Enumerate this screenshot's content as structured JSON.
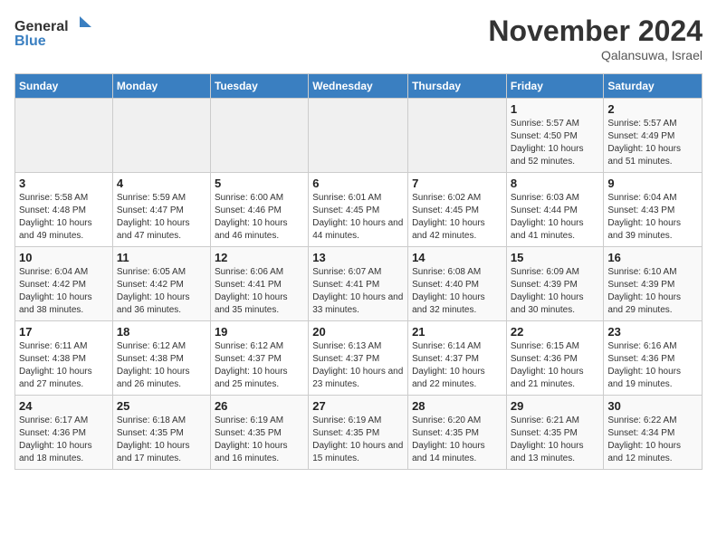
{
  "logo": {
    "general": "General",
    "blue": "Blue"
  },
  "header": {
    "month": "November 2024",
    "location": "Qalansuwa, Israel"
  },
  "weekdays": [
    "Sunday",
    "Monday",
    "Tuesday",
    "Wednesday",
    "Thursday",
    "Friday",
    "Saturday"
  ],
  "weeks": [
    [
      {
        "day": "",
        "sunrise": "",
        "sunset": "",
        "daylight": ""
      },
      {
        "day": "",
        "sunrise": "",
        "sunset": "",
        "daylight": ""
      },
      {
        "day": "",
        "sunrise": "",
        "sunset": "",
        "daylight": ""
      },
      {
        "day": "",
        "sunrise": "",
        "sunset": "",
        "daylight": ""
      },
      {
        "day": "",
        "sunrise": "",
        "sunset": "",
        "daylight": ""
      },
      {
        "day": "1",
        "sunrise": "Sunrise: 5:57 AM",
        "sunset": "Sunset: 4:50 PM",
        "daylight": "Daylight: 10 hours and 52 minutes."
      },
      {
        "day": "2",
        "sunrise": "Sunrise: 5:57 AM",
        "sunset": "Sunset: 4:49 PM",
        "daylight": "Daylight: 10 hours and 51 minutes."
      }
    ],
    [
      {
        "day": "3",
        "sunrise": "Sunrise: 5:58 AM",
        "sunset": "Sunset: 4:48 PM",
        "daylight": "Daylight: 10 hours and 49 minutes."
      },
      {
        "day": "4",
        "sunrise": "Sunrise: 5:59 AM",
        "sunset": "Sunset: 4:47 PM",
        "daylight": "Daylight: 10 hours and 47 minutes."
      },
      {
        "day": "5",
        "sunrise": "Sunrise: 6:00 AM",
        "sunset": "Sunset: 4:46 PM",
        "daylight": "Daylight: 10 hours and 46 minutes."
      },
      {
        "day": "6",
        "sunrise": "Sunrise: 6:01 AM",
        "sunset": "Sunset: 4:45 PM",
        "daylight": "Daylight: 10 hours and 44 minutes."
      },
      {
        "day": "7",
        "sunrise": "Sunrise: 6:02 AM",
        "sunset": "Sunset: 4:45 PM",
        "daylight": "Daylight: 10 hours and 42 minutes."
      },
      {
        "day": "8",
        "sunrise": "Sunrise: 6:03 AM",
        "sunset": "Sunset: 4:44 PM",
        "daylight": "Daylight: 10 hours and 41 minutes."
      },
      {
        "day": "9",
        "sunrise": "Sunrise: 6:04 AM",
        "sunset": "Sunset: 4:43 PM",
        "daylight": "Daylight: 10 hours and 39 minutes."
      }
    ],
    [
      {
        "day": "10",
        "sunrise": "Sunrise: 6:04 AM",
        "sunset": "Sunset: 4:42 PM",
        "daylight": "Daylight: 10 hours and 38 minutes."
      },
      {
        "day": "11",
        "sunrise": "Sunrise: 6:05 AM",
        "sunset": "Sunset: 4:42 PM",
        "daylight": "Daylight: 10 hours and 36 minutes."
      },
      {
        "day": "12",
        "sunrise": "Sunrise: 6:06 AM",
        "sunset": "Sunset: 4:41 PM",
        "daylight": "Daylight: 10 hours and 35 minutes."
      },
      {
        "day": "13",
        "sunrise": "Sunrise: 6:07 AM",
        "sunset": "Sunset: 4:41 PM",
        "daylight": "Daylight: 10 hours and 33 minutes."
      },
      {
        "day": "14",
        "sunrise": "Sunrise: 6:08 AM",
        "sunset": "Sunset: 4:40 PM",
        "daylight": "Daylight: 10 hours and 32 minutes."
      },
      {
        "day": "15",
        "sunrise": "Sunrise: 6:09 AM",
        "sunset": "Sunset: 4:39 PM",
        "daylight": "Daylight: 10 hours and 30 minutes."
      },
      {
        "day": "16",
        "sunrise": "Sunrise: 6:10 AM",
        "sunset": "Sunset: 4:39 PM",
        "daylight": "Daylight: 10 hours and 29 minutes."
      }
    ],
    [
      {
        "day": "17",
        "sunrise": "Sunrise: 6:11 AM",
        "sunset": "Sunset: 4:38 PM",
        "daylight": "Daylight: 10 hours and 27 minutes."
      },
      {
        "day": "18",
        "sunrise": "Sunrise: 6:12 AM",
        "sunset": "Sunset: 4:38 PM",
        "daylight": "Daylight: 10 hours and 26 minutes."
      },
      {
        "day": "19",
        "sunrise": "Sunrise: 6:12 AM",
        "sunset": "Sunset: 4:37 PM",
        "daylight": "Daylight: 10 hours and 25 minutes."
      },
      {
        "day": "20",
        "sunrise": "Sunrise: 6:13 AM",
        "sunset": "Sunset: 4:37 PM",
        "daylight": "Daylight: 10 hours and 23 minutes."
      },
      {
        "day": "21",
        "sunrise": "Sunrise: 6:14 AM",
        "sunset": "Sunset: 4:37 PM",
        "daylight": "Daylight: 10 hours and 22 minutes."
      },
      {
        "day": "22",
        "sunrise": "Sunrise: 6:15 AM",
        "sunset": "Sunset: 4:36 PM",
        "daylight": "Daylight: 10 hours and 21 minutes."
      },
      {
        "day": "23",
        "sunrise": "Sunrise: 6:16 AM",
        "sunset": "Sunset: 4:36 PM",
        "daylight": "Daylight: 10 hours and 19 minutes."
      }
    ],
    [
      {
        "day": "24",
        "sunrise": "Sunrise: 6:17 AM",
        "sunset": "Sunset: 4:36 PM",
        "daylight": "Daylight: 10 hours and 18 minutes."
      },
      {
        "day": "25",
        "sunrise": "Sunrise: 6:18 AM",
        "sunset": "Sunset: 4:35 PM",
        "daylight": "Daylight: 10 hours and 17 minutes."
      },
      {
        "day": "26",
        "sunrise": "Sunrise: 6:19 AM",
        "sunset": "Sunset: 4:35 PM",
        "daylight": "Daylight: 10 hours and 16 minutes."
      },
      {
        "day": "27",
        "sunrise": "Sunrise: 6:19 AM",
        "sunset": "Sunset: 4:35 PM",
        "daylight": "Daylight: 10 hours and 15 minutes."
      },
      {
        "day": "28",
        "sunrise": "Sunrise: 6:20 AM",
        "sunset": "Sunset: 4:35 PM",
        "daylight": "Daylight: 10 hours and 14 minutes."
      },
      {
        "day": "29",
        "sunrise": "Sunrise: 6:21 AM",
        "sunset": "Sunset: 4:35 PM",
        "daylight": "Daylight: 10 hours and 13 minutes."
      },
      {
        "day": "30",
        "sunrise": "Sunrise: 6:22 AM",
        "sunset": "Sunset: 4:34 PM",
        "daylight": "Daylight: 10 hours and 12 minutes."
      }
    ]
  ]
}
